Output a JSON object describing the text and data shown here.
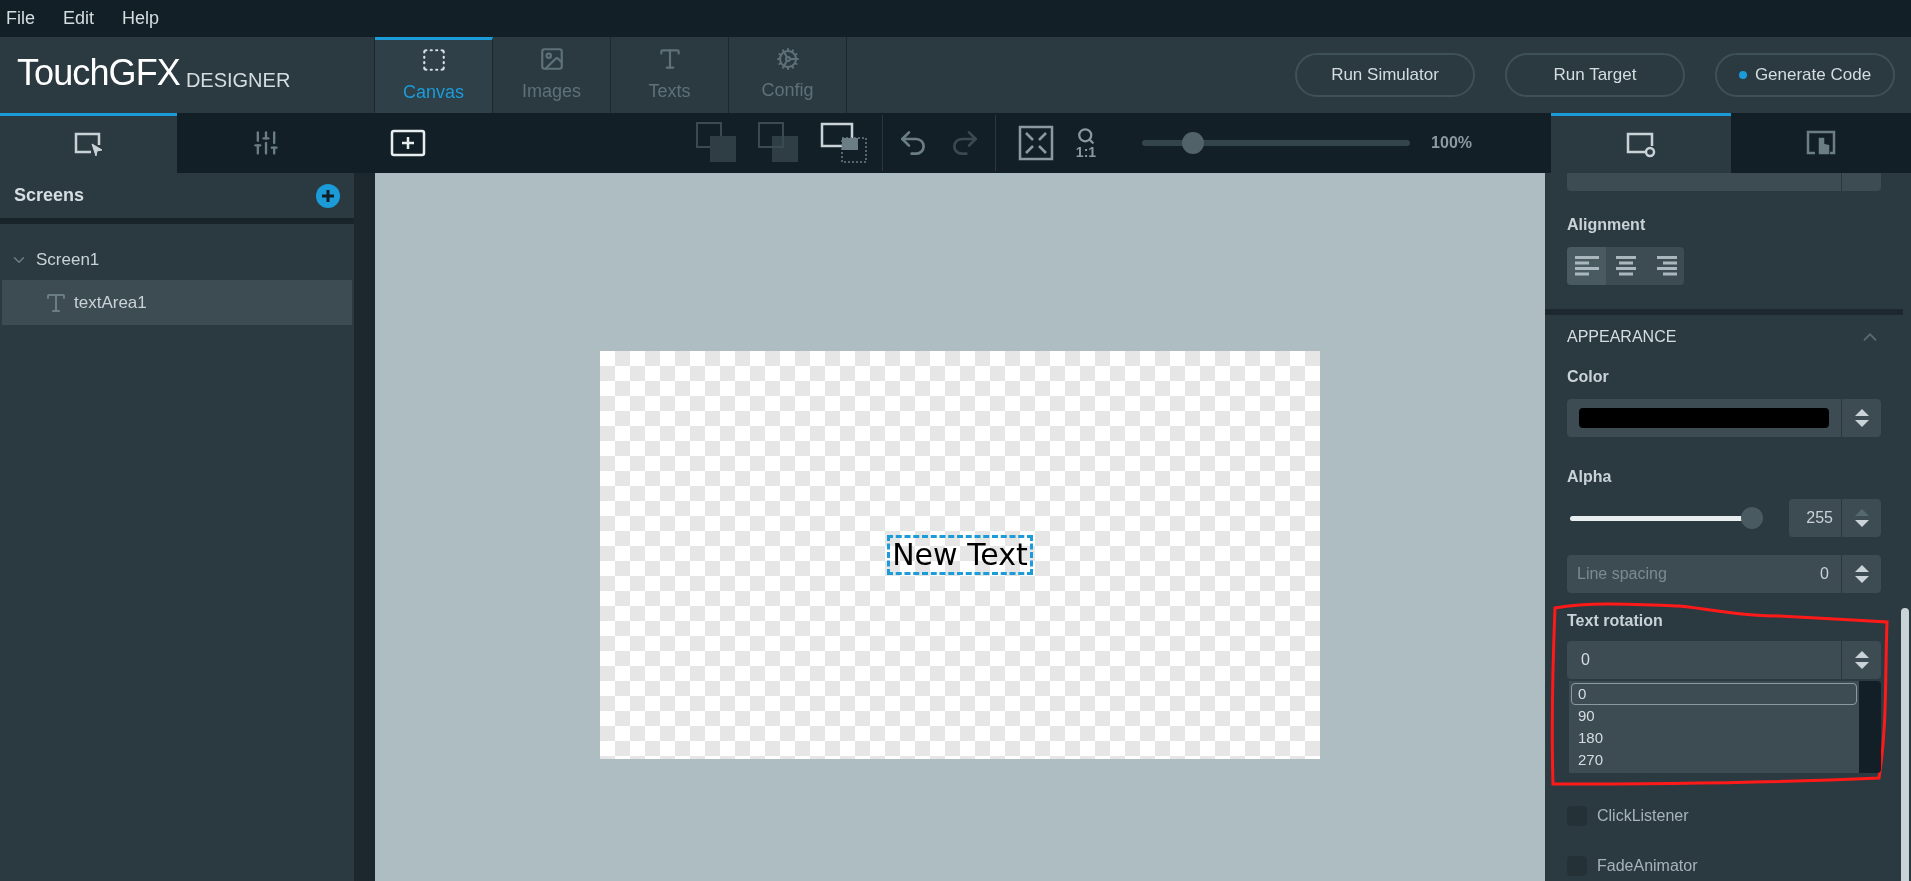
{
  "menu_bar": [
    "File",
    "Edit",
    "Help"
  ],
  "logo": {
    "main": "TouchGFX",
    "sub": "DESIGNER"
  },
  "main_tabs": [
    {
      "label": "Canvas",
      "kind": "canvas",
      "selected": true
    },
    {
      "label": "Images",
      "kind": "images",
      "selected": false
    },
    {
      "label": "Texts",
      "kind": "texts",
      "selected": false
    },
    {
      "label": "Config",
      "kind": "config",
      "selected": false
    }
  ],
  "actions": [
    {
      "label": "Run Simulator",
      "dot": false
    },
    {
      "label": "Run Target",
      "dot": false
    },
    {
      "label": "Generate Code",
      "dot": true
    }
  ],
  "left_tabs": [
    {
      "kind": "screens",
      "selected": true
    },
    {
      "kind": "mixer",
      "selected": false
    }
  ],
  "toolbar": {
    "zoom": {
      "level": 0.19,
      "reading": "100%"
    },
    "zoom_one": "1:1"
  },
  "screens": {
    "title": "Screens",
    "tree": [
      {
        "label": "Screen1",
        "expanded": true,
        "selected": false,
        "children": [
          {
            "label": "textArea1",
            "selected": true
          }
        ]
      }
    ]
  },
  "canvas": {
    "text": "New Text",
    "selected": true
  },
  "right_tabs": [
    {
      "kind": "properties",
      "selected": true
    },
    {
      "kind": "interactions",
      "selected": false
    }
  ],
  "properties": {
    "alignment": {
      "label": "Alignment",
      "options": [
        {
          "kind": "left",
          "selected": true
        },
        {
          "kind": "center",
          "selected": false
        },
        {
          "kind": "right",
          "selected": false
        }
      ]
    },
    "appearance": {
      "title": "APPEARANCE",
      "expanded": true,
      "color": {
        "label": "Color",
        "color": "#000000"
      },
      "alpha": {
        "label": "Alpha",
        "level": 1,
        "value": "255"
      },
      "line_spacing": {
        "placeholder": "Line spacing",
        "value": "0"
      },
      "text_rotation": {
        "label": "Text rotation",
        "value": "0",
        "expanded": true,
        "options": [
          {
            "label": "0",
            "selected": true
          },
          {
            "label": "90",
            "selected": false
          },
          {
            "label": "180",
            "selected": false
          },
          {
            "label": "270",
            "selected": false
          }
        ]
      }
    },
    "mixins": [
      {
        "label": "ClickListener",
        "checked": false
      },
      {
        "label": "FadeAnimator",
        "checked": false
      }
    ]
  }
}
